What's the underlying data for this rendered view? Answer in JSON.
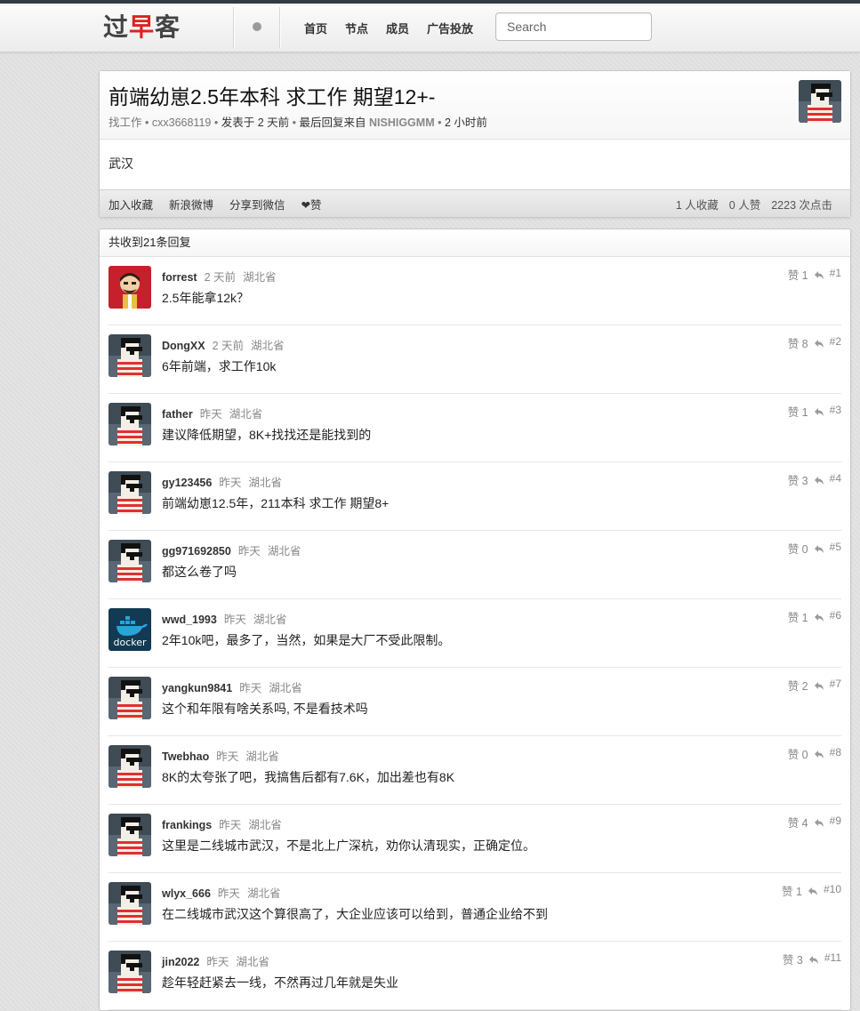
{
  "nav": {
    "logo": {
      "part1": "过",
      "part2": "早",
      "part3": "客"
    },
    "links": [
      "首页",
      "节点",
      "成员",
      "广告投放"
    ],
    "search_placeholder": "Search"
  },
  "topic": {
    "title": "前端幼崽2.5年本科 求工作 期望12+-",
    "node": "找工作",
    "author": "cxx3668119",
    "posted": "发表于 2 天前",
    "last_reply_prefix": "最后回复来自",
    "last_reply_user": "NISHIGGMM",
    "last_reply_time": "2 小时前",
    "sep": "•",
    "body": "武汉",
    "actions": [
      "加入收藏",
      "新浪微博",
      "分享到微信",
      "❤赞"
    ],
    "stats": [
      "1 人收藏",
      "0 人赞",
      "2223 次点击"
    ]
  },
  "replies": {
    "header": "共收到21条回复",
    "items": [
      {
        "user": "forrest",
        "time": "2 天前",
        "loc": "湖北省",
        "content": "2.5年能拿12k？",
        "likes": "赞 1",
        "num": "#1",
        "avatar": "cartoon"
      },
      {
        "user": "DongXX",
        "time": "2 天前",
        "loc": "湖北省",
        "content": "6年前端，求工作10k",
        "likes": "赞 8",
        "num": "#2",
        "avatar": "pixel"
      },
      {
        "user": "father",
        "time": "昨天",
        "loc": "湖北省",
        "content": "建议降低期望，8K+找找还是能找到的",
        "likes": "赞 1",
        "num": "#3",
        "avatar": "pixel"
      },
      {
        "user": "gy123456",
        "time": "昨天",
        "loc": "湖北省",
        "content": "前端幼崽12.5年，211本科 求工作 期望8+",
        "likes": "赞 3",
        "num": "#4",
        "avatar": "pixel"
      },
      {
        "user": "gg971692850",
        "time": "昨天",
        "loc": "湖北省",
        "content": "都这么卷了吗",
        "likes": "赞 0",
        "num": "#5",
        "avatar": "pixel"
      },
      {
        "user": "wwd_1993",
        "time": "昨天",
        "loc": "湖北省",
        "content": "2年10k吧，最多了，当然，如果是大厂不受此限制。",
        "likes": "赞 1",
        "num": "#6",
        "avatar": "docker",
        "avatar_text": "docker"
      },
      {
        "user": "yangkun9841",
        "time": "昨天",
        "loc": "湖北省",
        "content": "这个和年限有啥关系吗, 不是看技术吗",
        "likes": "赞 2",
        "num": "#7",
        "avatar": "pixel"
      },
      {
        "user": "Twebhao",
        "time": "昨天",
        "loc": "湖北省",
        "content": "8K的太夸张了吧，我搞售后都有7.6K，加出差也有8K",
        "likes": "赞 0",
        "num": "#8",
        "avatar": "pixel"
      },
      {
        "user": "frankings",
        "time": "昨天",
        "loc": "湖北省",
        "content": "这里是二线城市武汉，不是北上广深杭，劝你认清现实，正确定位。",
        "likes": "赞 4",
        "num": "#9",
        "avatar": "pixel"
      },
      {
        "user": "wlyx_666",
        "time": "昨天",
        "loc": "湖北省",
        "content": "在二线城市武汉这个算很高了，大企业应该可以给到，普通企业给不到",
        "likes": "赞 1",
        "num": "#10",
        "avatar": "pixel"
      },
      {
        "user": "jin2022",
        "time": "昨天",
        "loc": "湖北省",
        "content": "趁年轻赶紧去一线，不然再过几年就是失业",
        "likes": "赞 3",
        "num": "#11",
        "avatar": "pixel"
      }
    ]
  },
  "colors": {
    "logo_red": "#dd2222",
    "nav_bg": "#f4f4f4",
    "stripe_red": "#e03030"
  }
}
